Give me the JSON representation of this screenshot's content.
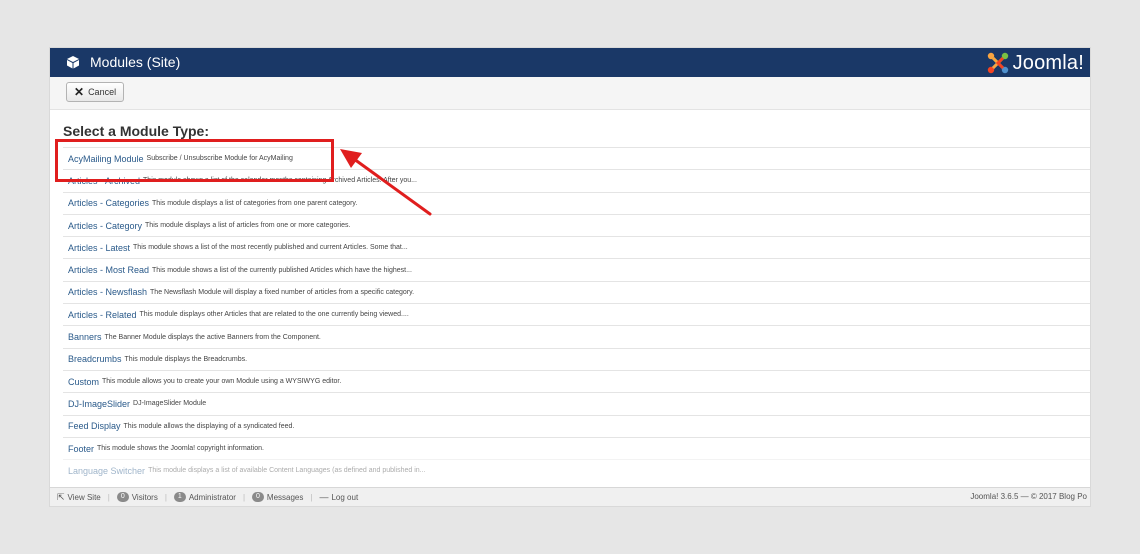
{
  "header": {
    "title": "Modules (Site)",
    "logo_text": "Joomla!",
    "bg_color": "#1a3867"
  },
  "toolbar": {
    "cancel_label": "Cancel"
  },
  "page": {
    "section_title": "Select a Module Type:"
  },
  "modules": [
    {
      "name": "AcyMailing Module",
      "desc": "Subscribe / Unsubscribe Module for AcyMailing"
    },
    {
      "name": "Articles - Archived",
      "desc": "This module shows a list of the calendar months containing Archived Articles. After you..."
    },
    {
      "name": "Articles - Categories",
      "desc": "This module displays a list of categories from one parent category."
    },
    {
      "name": "Articles - Category",
      "desc": "This module displays a list of articles from one or more categories."
    },
    {
      "name": "Articles - Latest",
      "desc": "This module shows a list of the most recently published and current Articles. Some that..."
    },
    {
      "name": "Articles - Most Read",
      "desc": "This module shows a list of the currently published Articles which have the highest..."
    },
    {
      "name": "Articles - Newsflash",
      "desc": "The Newsflash Module will display a fixed number of articles from a specific category."
    },
    {
      "name": "Articles - Related",
      "desc": "This module displays other Articles that are related to the one currently being viewed...."
    },
    {
      "name": "Banners",
      "desc": "The Banner Module displays the active Banners from the Component."
    },
    {
      "name": "Breadcrumbs",
      "desc": "This module displays the Breadcrumbs."
    },
    {
      "name": "Custom",
      "desc": "This module allows you to create your own Module using a WYSIWYG editor."
    },
    {
      "name": "DJ-ImageSlider",
      "desc": "DJ-ImageSlider Module"
    },
    {
      "name": "Feed Display",
      "desc": "This module allows the displaying of a syndicated feed."
    },
    {
      "name": "Footer",
      "desc": "This module shows the Joomla! copyright information."
    },
    {
      "name": "Language Switcher",
      "desc": "This module displays a list of available Content Languages (as defined and published in..."
    }
  ],
  "status": {
    "view_site": "View Site",
    "visitors_count": "0",
    "visitors_label": "Visitors",
    "admin_count": "1",
    "admin_label": "Administrator",
    "messages_count": "0",
    "messages_label": "Messages",
    "logout_label": "Log out",
    "version_text": "Joomla! 3.6.5 — © 2017 Blog Po"
  },
  "annotation": {
    "highlight_color": "#e01e1e"
  }
}
